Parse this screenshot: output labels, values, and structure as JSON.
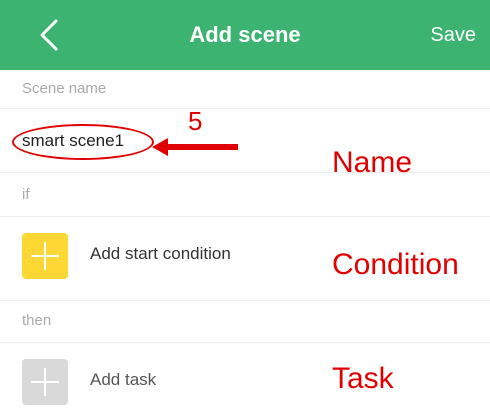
{
  "header": {
    "back_icon": "chevron-left-icon",
    "title": "Add scene",
    "save_label": "Save",
    "color": "#3cb371"
  },
  "scene_name": {
    "section_label": "Scene name",
    "value": "smart scene1"
  },
  "if_section": {
    "section_label": "if",
    "add_condition_label": "Add start condition",
    "icon": "plus-icon",
    "icon_color": "#fdd835"
  },
  "then_section": {
    "section_label": "then",
    "add_task_label": "Add task",
    "icon": "plus-icon",
    "icon_color": "#d9d9d9"
  },
  "annotations": {
    "step_number": "5",
    "name_caption": "Name",
    "condition_caption": "Condition",
    "task_caption": "Task",
    "color": "#e00000"
  }
}
